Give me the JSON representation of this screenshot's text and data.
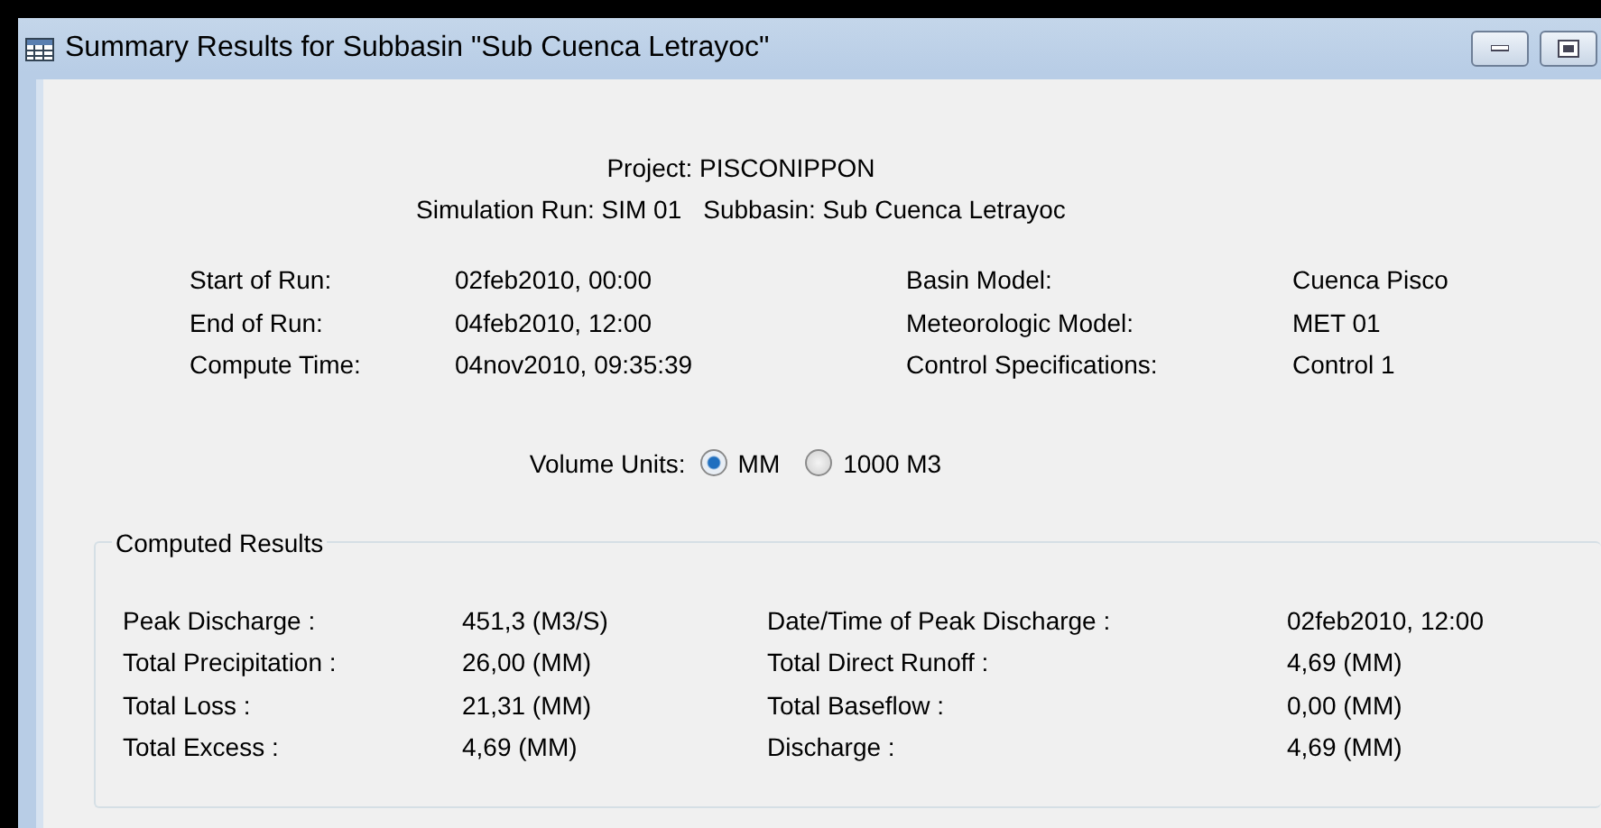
{
  "window": {
    "title": "Summary Results for Subbasin \"Sub Cuenca Letrayoc\""
  },
  "header": {
    "project": "Project: PISCONIPPON",
    "run_line": [
      {
        "text": "Simulation Run: SIM 01"
      },
      {
        "text": "Subbasin: Sub Cuenca Letrayoc"
      }
    ]
  },
  "run_info": [
    {
      "label": "Start of Run:",
      "value": "02feb2010, 00:00",
      "label2": "Basin Model:",
      "value2": "Cuenca Pisco"
    },
    {
      "label": "End of Run:",
      "value": "04feb2010, 12:00",
      "label2": "Meteorologic Model:",
      "value2": "MET 01"
    },
    {
      "label": "Compute Time:",
      "value": "04nov2010, 09:35:39",
      "label2": "Control Specifications:",
      "value2": "Control 1"
    }
  ],
  "volume_units": {
    "label": "Volume Units:",
    "options": [
      {
        "label": "MM",
        "selected": true
      },
      {
        "label": "1000 M3",
        "selected": false
      }
    ]
  },
  "computed_results": {
    "title": "Computed Results",
    "rows": [
      {
        "label": "Peak Discharge :",
        "value": "451,3 (M3/S)",
        "label2": "Date/Time of Peak Discharge :",
        "value2": "02feb2010, 12:00"
      },
      {
        "label": "Total Precipitation :",
        "value": "26,00 (MM)",
        "label2": "Total Direct Runoff :",
        "value2": "4,69 (MM)"
      },
      {
        "label": "Total Loss :",
        "value": "21,31 (MM)",
        "label2": "Total Baseflow :",
        "value2": "0,00 (MM)"
      },
      {
        "label": "Total Excess :",
        "value": "4,69 (MM)",
        "label2": "Discharge :",
        "value2": "4,69 (MM)"
      }
    ]
  }
}
